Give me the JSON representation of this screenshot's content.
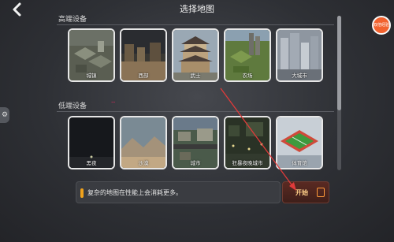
{
  "header": {
    "title": "选择地图",
    "back_icon": "chevron-left-icon",
    "badge_text": "双倍经验"
  },
  "sections": [
    {
      "title": "高端设备",
      "maps": [
        {
          "label": "城镇",
          "icon": "map-town"
        },
        {
          "label": "西部",
          "icon": "map-west"
        },
        {
          "label": "武士",
          "icon": "map-samurai"
        },
        {
          "label": "农场",
          "icon": "map-farm"
        },
        {
          "label": "大城市",
          "icon": "map-big-city"
        }
      ]
    },
    {
      "title": "低端设备",
      "maps": [
        {
          "label": "黑夜",
          "icon": "map-night"
        },
        {
          "label": "沙漠",
          "icon": "map-desert"
        },
        {
          "label": "城市",
          "icon": "map-city"
        },
        {
          "label": "狂暴夜晚城市",
          "icon": "map-night-city"
        },
        {
          "label": "体育馆",
          "icon": "map-stadium"
        }
      ]
    }
  ],
  "notice": {
    "icon": "exclamation-icon",
    "text": "复杂的地图在性能上会消耗更多。"
  },
  "start_button": {
    "label": "开始",
    "icon": "exit-door-icon"
  },
  "colors": {
    "accent_orange": "#f0a21c",
    "annotation_red": "#e03a3a",
    "start_button_bg": "#4a2520"
  }
}
